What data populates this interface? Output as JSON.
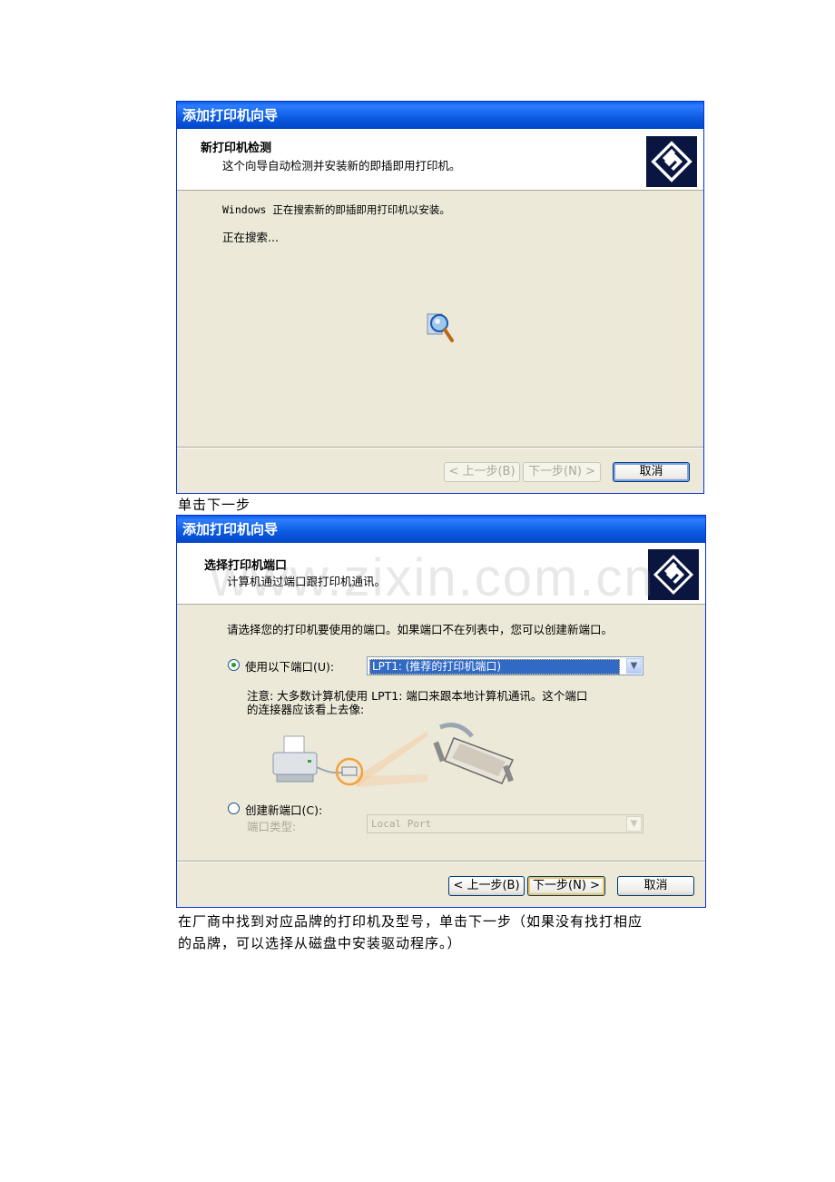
{
  "dialog1": {
    "title": "添加打印机向导",
    "header_title": "新打印机检测",
    "header_sub": "这个向导自动检测并安装新的即插即用打印机。",
    "line1": "Windows 正在搜索新的即插即用打印机以安装。",
    "line2": "正在搜索...",
    "back_button": "< 上一步(B)",
    "next_button": "下一步(N) >",
    "cancel_button": "取消"
  },
  "caption1": "单击下一步",
  "dialog2": {
    "title": "添加打印机向导",
    "header_title": "选择打印机端口",
    "header_sub": "计算机通过端口跟打印机通讯。",
    "instruction": "请选择您的打印机要使用的端口。如果端口不在列表中，您可以创建新端口。",
    "radio_use_label": "使用以下端口(U):",
    "port_selected": "LPT1: (推荐的打印机端口)",
    "note_line1": "注意: 大多数计算机使用 LPT1: 端口来跟本地计算机通讯。这个端口",
    "note_line2": "的连接器应该看上去像:",
    "radio_create_label": "创建新端口(C):",
    "port_type_label": "端口类型:",
    "port_type_value": "Local Port",
    "back_button": "< 上一步(B)",
    "next_button": "下一步(N) >",
    "cancel_button": "取消"
  },
  "caption2_line1": "在厂商中找到对应品牌的打印机及型号，单击下一步（如果没有找打相应",
  "caption2_line2": "的品牌，可以选择从磁盘中安装驱动程序。）",
  "watermark": "www.zixin.com.cn",
  "colors": {
    "title_bar": "#0a5ae0",
    "dialog_bg": "#ece9d8",
    "select_highlight": "#316ac5"
  },
  "icons": [
    "printer-wizard-icon",
    "searching-magnifier-icon",
    "printer-icon",
    "lpt-port-icon",
    "parallel-cable-icon",
    "dropdown-arrow-icon"
  ]
}
